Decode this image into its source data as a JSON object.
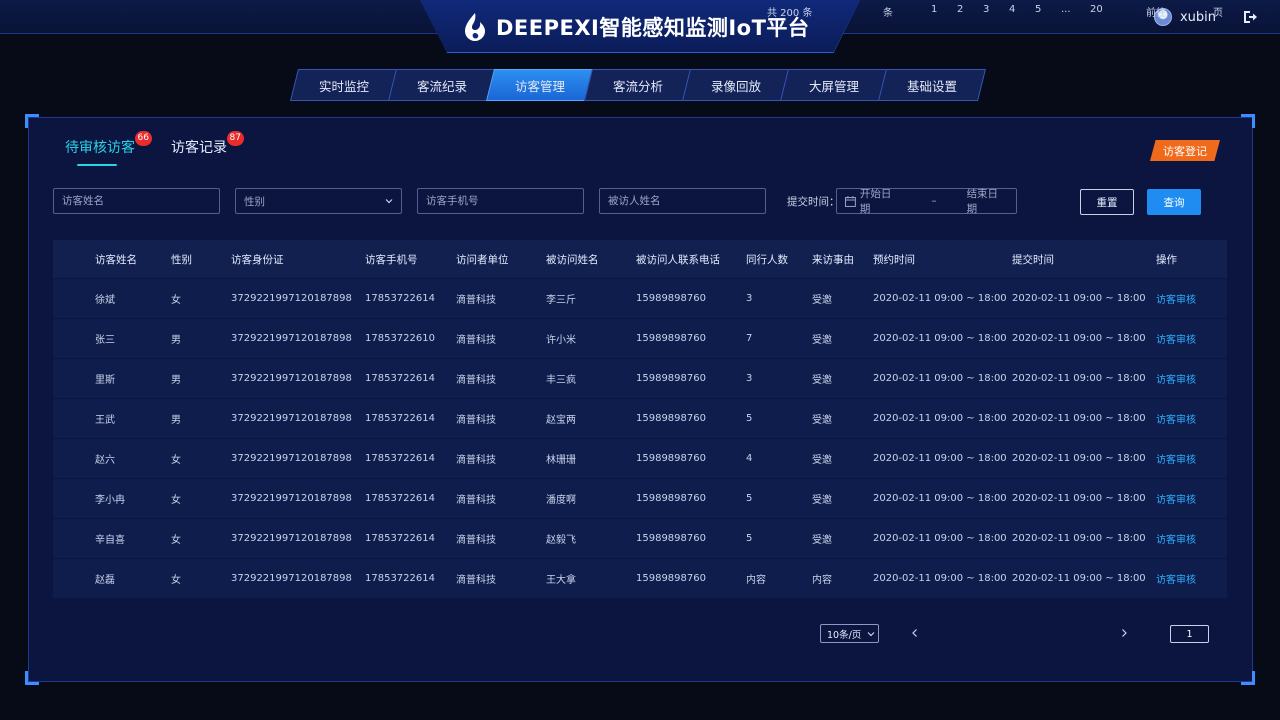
{
  "header": {
    "title": "DEEPEXI智能感知监测IoT平台",
    "username": "xubin"
  },
  "nav": {
    "tabs": [
      {
        "label": "实时监控",
        "active": false
      },
      {
        "label": "客流纪录",
        "active": false
      },
      {
        "label": "访客管理",
        "active": true
      },
      {
        "label": "客流分析",
        "active": false
      },
      {
        "label": "录像回放",
        "active": false
      },
      {
        "label": "大屏管理",
        "active": false
      },
      {
        "label": "基础设置",
        "active": false
      }
    ]
  },
  "subtabs": [
    {
      "label": "待审核访客",
      "badge": "66",
      "active": true
    },
    {
      "label": "访客记录",
      "badge": "87",
      "active": false
    }
  ],
  "register_button": "访客登记",
  "filters": {
    "visitor_name_placeholder": "访客姓名",
    "gender_placeholder": "性别",
    "phone_placeholder": "访客手机号",
    "visitee_placeholder": "被访人姓名",
    "time_label": "提交时间：",
    "start_date": "开始日期",
    "range_sep": "–",
    "end_date": "结束日期",
    "reset": "重置",
    "query": "查询"
  },
  "table": {
    "headers": [
      "访客姓名",
      "性别",
      "访客身份证",
      "访客手机号",
      "访问者单位",
      "被访问姓名",
      "被访问人联系电话",
      "同行人数",
      "来访事由",
      "预约时间",
      "提交时间",
      "操作"
    ],
    "rows": [
      [
        "徐斌",
        "女",
        "372922199712018789​8",
        "17853722614",
        "滴普科技",
        "李三斤",
        "15989898760",
        "3",
        "受邀",
        "2020-02-11 09:00 ~ 18:00",
        "2020-02-11 09:00 ~ 18:00",
        "访客审核"
      ],
      [
        "张三",
        "男",
        "372922199712018789​8",
        "17853722610",
        "滴普科技",
        "许小米",
        "15989898760",
        "7",
        "受邀",
        "2020-02-11 09:00 ~ 18:00",
        "2020-02-11 09:00 ~ 18:00",
        "访客审核"
      ],
      [
        "里斯",
        "男",
        "372922199712018789​8",
        "17853722614",
        "滴普科技",
        "丰三疯",
        "15989898760",
        "3",
        "受邀",
        "2020-02-11 09:00 ~ 18:00",
        "2020-02-11 09:00 ~ 18:00",
        "访客审核"
      ],
      [
        "王武",
        "男",
        "372922199712018789​8",
        "17853722614",
        "滴普科技",
        "赵宝两",
        "15989898760",
        "5",
        "受邀",
        "2020-02-11 09:00 ~ 18:00",
        "2020-02-11 09:00 ~ 18:00",
        "访客审核"
      ],
      [
        "赵六",
        "女",
        "372922199712018789​8",
        "17853722614",
        "滴普科技",
        "林珊珊",
        "15989898760",
        "4",
        "受邀",
        "2020-02-11 09:00 ~ 18:00",
        "2020-02-11 09:00 ~ 18:00",
        "访客审核"
      ],
      [
        "李小冉",
        "女",
        "372922199712018789​8",
        "17853722614",
        "滴普科技",
        "潘度啊",
        "15989898760",
        "5",
        "受邀",
        "2020-02-11 09:00 ~ 18:00",
        "2020-02-11 09:00 ~ 18:00",
        "访客审核"
      ],
      [
        "辛自喜",
        "女",
        "372922199712018789​8",
        "17853722614",
        "滴普科技",
        "赵毅飞",
        "15989898760",
        "5",
        "受邀",
        "2020-02-11 09:00 ~ 18:00",
        "2020-02-11 09:00 ~ 18:00",
        "访客审核"
      ],
      [
        "赵磊",
        "女",
        "372922199712018789​8",
        "17853722614",
        "滴普科技",
        "王大拿",
        "15989898760",
        "内容",
        "内容",
        "2020-02-11 09:00 ~ 18:00",
        "2020-02-11 09:00 ~ 18:00",
        "访客审核"
      ]
    ]
  },
  "pagination": {
    "total_text": "共 200 条",
    "page_size": "10条/页",
    "unit": "条",
    "pages": [
      "1",
      "2",
      "3",
      "4",
      "5",
      "...",
      "20"
    ],
    "goto_label": "前往",
    "goto_value": "1",
    "goto_suffix": "页"
  },
  "colors": {
    "accent": "#1f8cf2",
    "active_subtab": "#27d3e8",
    "badge": "#ea2c2c",
    "register": "#f06a1c",
    "link": "#2ab0ff"
  }
}
